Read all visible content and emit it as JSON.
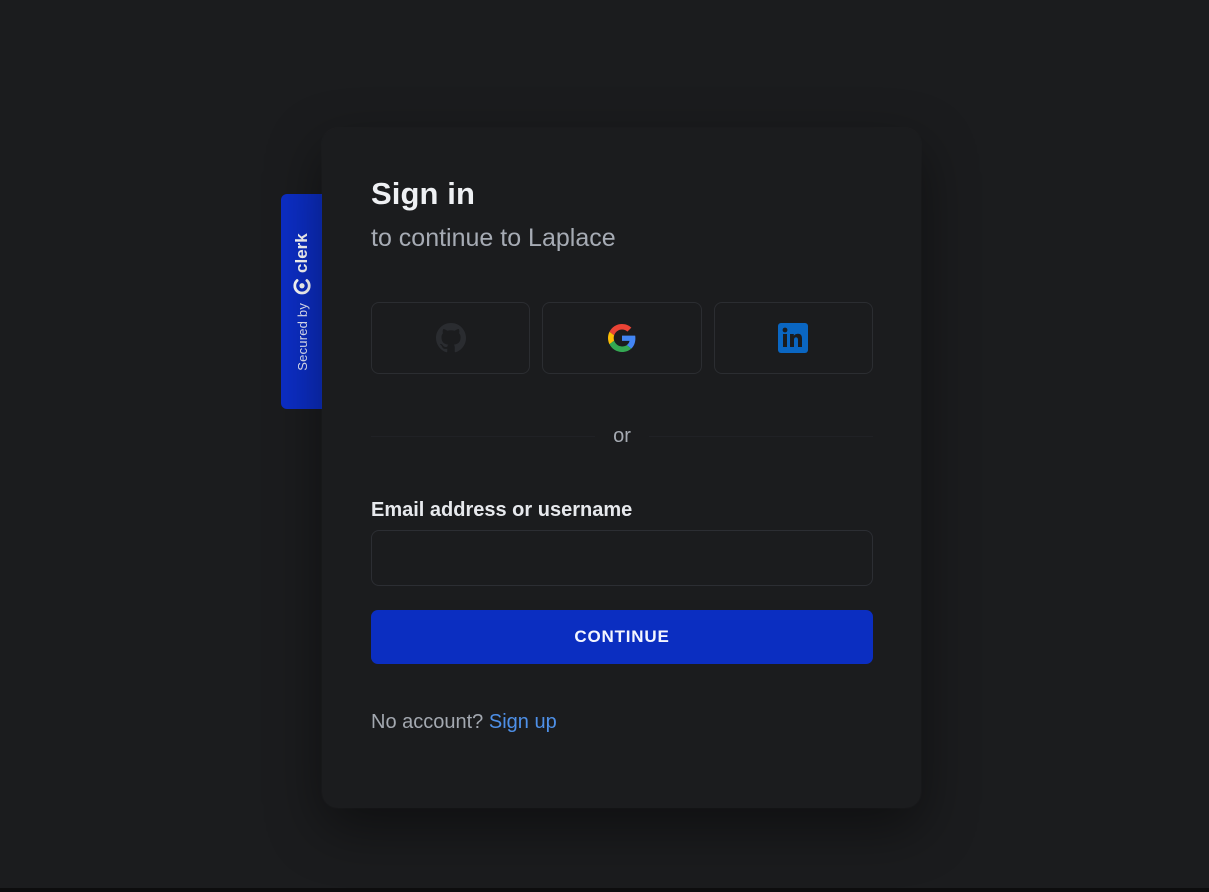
{
  "badge": {
    "secured_by": "Secured by",
    "brand": "clerk",
    "color": "#0c2ec6"
  },
  "header": {
    "title": "Sign in",
    "subtitle": "to continue to Laplace"
  },
  "social": {
    "providers": [
      {
        "name": "GitHub",
        "icon": "github-icon"
      },
      {
        "name": "Google",
        "icon": "google-icon"
      },
      {
        "name": "LinkedIn",
        "icon": "linkedin-icon"
      }
    ]
  },
  "divider": {
    "text": "or"
  },
  "form": {
    "email_label": "Email address or username",
    "email_value": "",
    "email_placeholder": "",
    "continue_label": "CONTINUE"
  },
  "footer": {
    "prompt": "No account?",
    "signup_label": "Sign up"
  },
  "colors": {
    "background": "#1b1c1e",
    "primary": "#0b2ec1",
    "link": "#4e90e8",
    "linkedin": "#0a66c2"
  }
}
